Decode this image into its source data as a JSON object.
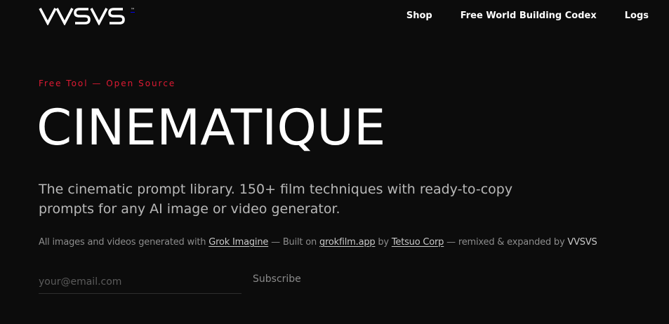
{
  "brand": {
    "logo_text": "VVSVS",
    "trademark": "™"
  },
  "nav": {
    "items": [
      {
        "label": "Shop"
      },
      {
        "label": "Free World Building Codex"
      },
      {
        "label": "Logs"
      }
    ]
  },
  "hero": {
    "eyebrow": "Free Tool — Open Source",
    "title": "CINEMATIQUE",
    "subtitle": "The cinematic prompt library. 150+ film techniques with ready-to-copy prompts for any AI image or video generator."
  },
  "credits": {
    "prefix": "All images and videos generated with ",
    "link1": "Grok Imagine",
    "middle1": " — Built on ",
    "link2": "grokfilm.app",
    "middle2": " by ",
    "link3": "Tetsuo Corp",
    "middle3": " — remixed & expanded by ",
    "brand": "VVSVS"
  },
  "subscribe": {
    "placeholder": "your@email.com",
    "value": "",
    "button_label": "Subscribe"
  },
  "colors": {
    "background": "#0c0c0c",
    "accent": "#e01a33",
    "text": "#ffffff",
    "muted": "#b8b8b8"
  }
}
